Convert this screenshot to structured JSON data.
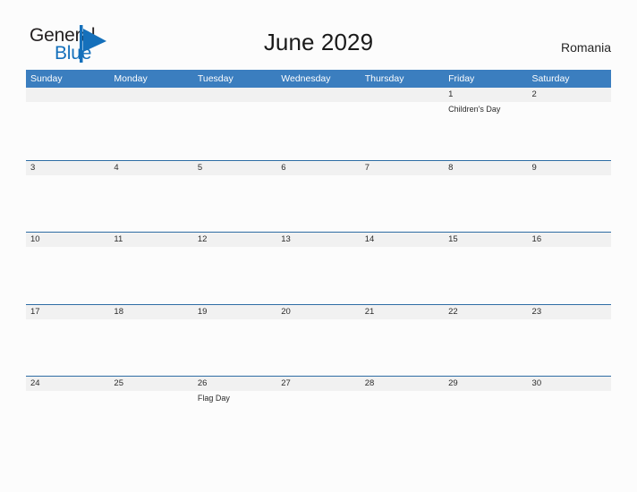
{
  "brand": {
    "name_top": "General",
    "name_bottom": "Blue",
    "mark": "triangle-flag",
    "color_dark": "#231f20",
    "color_blue": "#1570bb"
  },
  "header": {
    "title": "June 2029",
    "country": "Romania"
  },
  "theme": {
    "header_blue": "#3b7ebf",
    "row_line_blue": "#2e6da4",
    "date_band_gray": "#f1f1f1",
    "page_background": "#fcfcfc",
    "text_dark": "#2b2b2b"
  },
  "calendar": {
    "weekdays": [
      "Sunday",
      "Monday",
      "Tuesday",
      "Wednesday",
      "Thursday",
      "Friday",
      "Saturday"
    ],
    "weeks": [
      [
        {
          "date": "",
          "event": ""
        },
        {
          "date": "",
          "event": ""
        },
        {
          "date": "",
          "event": ""
        },
        {
          "date": "",
          "event": ""
        },
        {
          "date": "",
          "event": ""
        },
        {
          "date": "1",
          "event": "Children's Day"
        },
        {
          "date": "2",
          "event": ""
        }
      ],
      [
        {
          "date": "3",
          "event": ""
        },
        {
          "date": "4",
          "event": ""
        },
        {
          "date": "5",
          "event": ""
        },
        {
          "date": "6",
          "event": ""
        },
        {
          "date": "7",
          "event": ""
        },
        {
          "date": "8",
          "event": ""
        },
        {
          "date": "9",
          "event": ""
        }
      ],
      [
        {
          "date": "10",
          "event": ""
        },
        {
          "date": "11",
          "event": ""
        },
        {
          "date": "12",
          "event": ""
        },
        {
          "date": "13",
          "event": ""
        },
        {
          "date": "14",
          "event": ""
        },
        {
          "date": "15",
          "event": ""
        },
        {
          "date": "16",
          "event": ""
        }
      ],
      [
        {
          "date": "17",
          "event": ""
        },
        {
          "date": "18",
          "event": ""
        },
        {
          "date": "19",
          "event": ""
        },
        {
          "date": "20",
          "event": ""
        },
        {
          "date": "21",
          "event": ""
        },
        {
          "date": "22",
          "event": ""
        },
        {
          "date": "23",
          "event": ""
        }
      ],
      [
        {
          "date": "24",
          "event": ""
        },
        {
          "date": "25",
          "event": ""
        },
        {
          "date": "26",
          "event": "Flag Day"
        },
        {
          "date": "27",
          "event": ""
        },
        {
          "date": "28",
          "event": ""
        },
        {
          "date": "29",
          "event": ""
        },
        {
          "date": "30",
          "event": ""
        }
      ]
    ]
  }
}
